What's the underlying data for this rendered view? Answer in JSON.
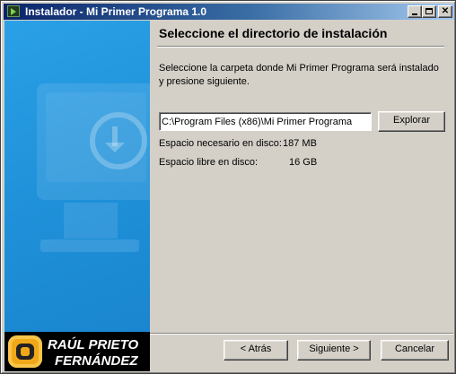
{
  "window": {
    "title": "Instalador - Mi Primer Programa 1.0"
  },
  "titlebar_buttons": {
    "minimize": "minimize-icon",
    "maximize": "maximize-icon",
    "close": "✕"
  },
  "page": {
    "heading": "Seleccione el directorio de instalación",
    "instructions": "Seleccione la carpeta donde Mi Primer Programa será instalado y presione siguiente.",
    "install_path": "C:\\Program Files (x86)\\Mi Primer Programa",
    "browse_label": "Explorar",
    "space_required_label": "Espacio necesario en disco:",
    "space_required_value": "187 MB",
    "space_free_label": "Espacio libre en disco:",
    "space_free_value": "16 GB"
  },
  "brand": {
    "line1": "RAÚL PRIETO",
    "line2": "FERNÁNDEZ"
  },
  "footer": {
    "back_label": "< Atrás",
    "next_label": "Siguiente >",
    "cancel_label": "Cancelar"
  },
  "colors": {
    "sidebar": "#1e8fd8",
    "titlebar": "#0a246a",
    "face": "#d4d0c8",
    "logo": "#f0a818"
  }
}
